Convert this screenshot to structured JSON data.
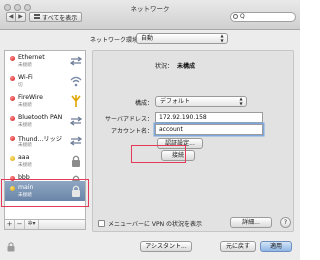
{
  "window": {
    "title": "ネットワーク"
  },
  "toolbar": {
    "show_all_label": "すべてを表示",
    "search_value": "Q"
  },
  "environment": {
    "label": "ネットワーク環境：",
    "value": "自動"
  },
  "services": [
    {
      "name": "Ethernet",
      "status": "未接続",
      "dot": "red",
      "icon": "ethernet-arrows-icon"
    },
    {
      "name": "Wi-Fi",
      "status": "切",
      "dot": "red",
      "icon": "wifi-icon"
    },
    {
      "name": "FireWire",
      "status": "未接続",
      "dot": "red",
      "icon": "firewire-icon"
    },
    {
      "name": "Bluetooth PAN",
      "status": "未接続",
      "dot": "red",
      "icon": "bluetooth-arrows-icon"
    },
    {
      "name": "Thund...リッジ",
      "status": "未接続",
      "dot": "red",
      "icon": "thunderbolt-arrows-icon"
    },
    {
      "name": "aaa",
      "status": "未接続",
      "dot": "yellow",
      "icon": "lock-icon"
    },
    {
      "name": "bbb",
      "status": "未接続",
      "dot": "red",
      "icon": "lock-icon"
    },
    {
      "name": "main",
      "status": "未接続",
      "dot": "yellow",
      "icon": "lock-icon",
      "selected": true
    }
  ],
  "list_buttons": {
    "add": "+",
    "remove": "−",
    "gear": "✲▾"
  },
  "detail": {
    "status_label": "状況：",
    "status_value": "未構成",
    "config_label": "構成：",
    "config_value": "デフォルト",
    "server_label": "サーバアドレス：",
    "server_value": "172.92.190.158",
    "account_label": "アカウント名：",
    "account_value": "account",
    "auth_button": "認証設定...",
    "connect_button": "接続"
  },
  "vpn": {
    "checkbox_label": "メニューバーに VPN の状況を表示",
    "checked": false
  },
  "advanced_button": "詳細...",
  "help": "?",
  "footer": {
    "assistant": "アシスタント...",
    "revert": "元に戻す",
    "apply": "適用"
  }
}
